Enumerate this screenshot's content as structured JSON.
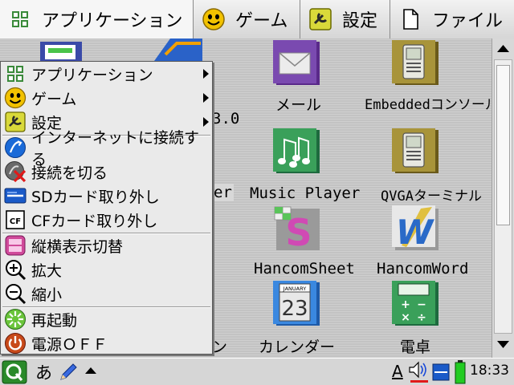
{
  "tabs": [
    {
      "label": "アプリケーション",
      "icon": "apps-grid-icon",
      "active": true
    },
    {
      "label": "ゲーム",
      "icon": "smiley-icon",
      "active": false
    },
    {
      "label": "設定",
      "icon": "settings-icon",
      "active": false
    },
    {
      "label": "ファイル",
      "icon": "file-icon",
      "active": false
    }
  ],
  "desktop": {
    "icons": [
      {
        "label": "メール",
        "icon": "mail-icon"
      },
      {
        "label": "Embeddedコンソール",
        "icon": "console-icon"
      },
      {
        "label": "Music Player",
        "icon": "music-icon"
      },
      {
        "label": "QVGAターミナル",
        "icon": "terminal-icon"
      },
      {
        "label": "HancomSheet",
        "icon": "sheet-icon"
      },
      {
        "label": "HancomWord",
        "icon": "word-icon"
      },
      {
        "label": "カレンダー",
        "icon": "calendar-icon"
      },
      {
        "label": "電卓",
        "icon": "calculator-icon"
      }
    ],
    "partial_labels": {
      "version": "3.0",
      "er": "er",
      "n": "ン"
    },
    "calendar_header": "JANUARY",
    "calendar_day": "23"
  },
  "menu": {
    "items": [
      {
        "label": "アプリケーション",
        "icon": "apps-grid-icon",
        "submenu": true
      },
      {
        "label": "ゲーム",
        "icon": "smiley-icon",
        "submenu": true
      },
      {
        "label": "設定",
        "icon": "settings-icon",
        "submenu": true
      },
      {
        "label": "インターネットに接続する",
        "icon": "internet-icon",
        "submenu": false
      },
      {
        "label": "接続を切る",
        "icon": "disconnect-icon",
        "submenu": false
      },
      {
        "label": "SDカード取り外し",
        "icon": "sd-card-icon",
        "submenu": false
      },
      {
        "label": "CFカード取り外し",
        "icon": "cf-card-icon",
        "submenu": false
      },
      {
        "label": "縦横表示切替",
        "icon": "rotate-icon",
        "submenu": false
      },
      {
        "label": "拡大",
        "icon": "zoom-in-icon",
        "submenu": false
      },
      {
        "label": "縮小",
        "icon": "zoom-out-icon",
        "submenu": false
      },
      {
        "label": "再起動",
        "icon": "restart-icon",
        "submenu": false
      },
      {
        "label": "電源ＯＦＦ",
        "icon": "power-icon",
        "submenu": false
      }
    ],
    "cf_badge": "CF"
  },
  "taskbar": {
    "ime": "あ",
    "keyboard_indicator": "A",
    "clock": "18:33"
  },
  "colors": {
    "accent_green": "#2a8a2a",
    "battery_green": "#22cc22"
  }
}
